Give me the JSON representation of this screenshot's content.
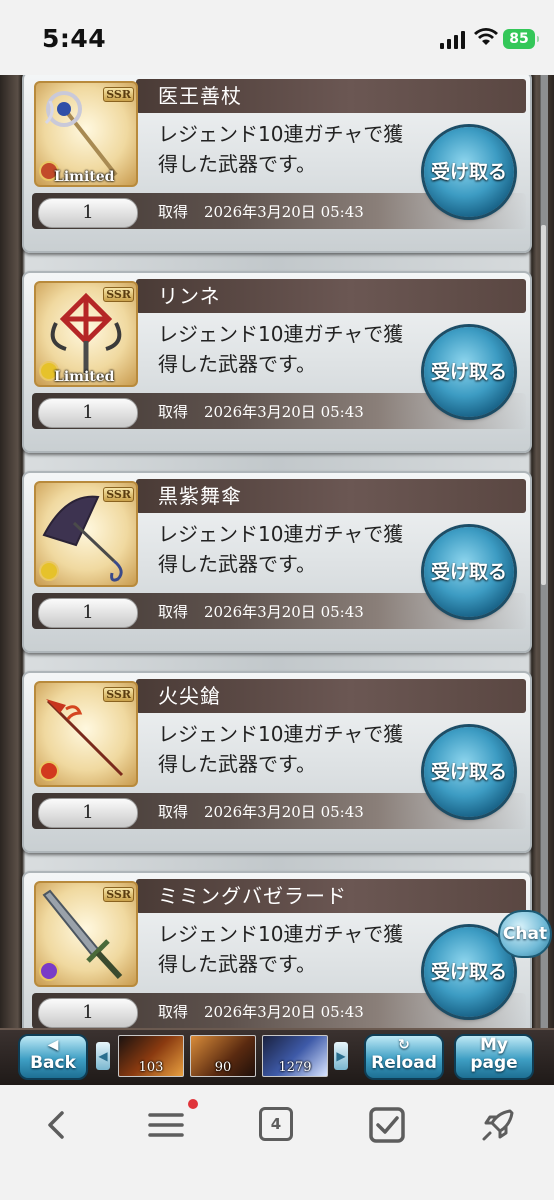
{
  "status": {
    "time": "5:44",
    "battery": "85"
  },
  "cards": [
    {
      "name": "医王善杖",
      "desc_line1": "レジェンド10連ガチャで獲",
      "desc_line2": "得した武器です。",
      "qty": "1",
      "acq_label": "取得",
      "acq_date": "2026年3月20日 05:43",
      "button": "受け取る",
      "rarity": "SSR",
      "limited": "Limited",
      "element_color": "#c24a2a"
    },
    {
      "name": "リンネ",
      "desc_line1": "レジェンド10連ガチャで獲",
      "desc_line2": "得した武器です。",
      "qty": "1",
      "acq_label": "取得",
      "acq_date": "2026年3月20日 05:43",
      "button": "受け取る",
      "rarity": "SSR",
      "limited": "Limited",
      "element_color": "#e6c22a"
    },
    {
      "name": "黒紫舞傘",
      "desc_line1": "レジェンド10連ガチャで獲",
      "desc_line2": "得した武器です。",
      "qty": "1",
      "acq_label": "取得",
      "acq_date": "2026年3月20日 05:43",
      "button": "受け取る",
      "rarity": "SSR",
      "limited": "",
      "element_color": "#e6c22a"
    },
    {
      "name": "火尖鎗",
      "desc_line1": "レジェンド10連ガチャで獲",
      "desc_line2": "得した武器です。",
      "qty": "1",
      "acq_label": "取得",
      "acq_date": "2026年3月20日 05:43",
      "button": "受け取る",
      "rarity": "SSR",
      "limited": "",
      "element_color": "#d23a1e"
    },
    {
      "name": "ミミングバゼラード",
      "desc_line1": "レジェンド10連ガチャで獲",
      "desc_line2": "得した武器です。",
      "qty": "1",
      "acq_label": "取得",
      "acq_date": "2026年3月20日 05:43",
      "button": "受け取る",
      "rarity": "SSR",
      "limited": "",
      "element_color": "#7a3cc7"
    }
  ],
  "chat": {
    "label": "Chat"
  },
  "game_nav": {
    "back_label": "Back",
    "reload_label": "Reload",
    "mypage_line1": "My",
    "mypage_line2": "page",
    "items": [
      {
        "count": "103"
      },
      {
        "count": "90"
      },
      {
        "count": "1279"
      }
    ]
  },
  "browser": {
    "tab_count": "4"
  }
}
